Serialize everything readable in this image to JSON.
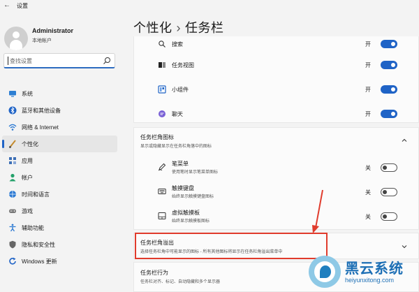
{
  "window": {
    "title": "设置"
  },
  "user": {
    "name": "Administrator",
    "account": "本地帐户"
  },
  "search": {
    "placeholder": "查找设置"
  },
  "nav": [
    {
      "label": "系统",
      "icon": "monitor-icon",
      "color": "#2d7fd3"
    },
    {
      "label": "蓝牙和其他设备",
      "icon": "bluetooth-icon",
      "color": "#1f63c6"
    },
    {
      "label": "网络 & Internet",
      "icon": "wifi-icon",
      "color": "#2a78d2"
    },
    {
      "label": "个性化",
      "icon": "brush-icon",
      "color": "#c48a2c",
      "active": true
    },
    {
      "label": "应用",
      "icon": "apps-icon",
      "color": "#3d6fb5"
    },
    {
      "label": "帐户",
      "icon": "person-icon",
      "color": "#23a06a"
    },
    {
      "label": "时间和语言",
      "icon": "globe-clock-icon",
      "color": "#2a78d2"
    },
    {
      "label": "游戏",
      "icon": "gamepad-icon",
      "color": "#777777"
    },
    {
      "label": "辅助功能",
      "icon": "accessibility-icon",
      "color": "#2a78d2"
    },
    {
      "label": "隐私和安全性",
      "icon": "shield-icon",
      "color": "#666666"
    },
    {
      "label": "Windows 更新",
      "icon": "update-icon",
      "color": "#1f63c6"
    }
  ],
  "breadcrumb": {
    "parent": "个性化",
    "separator": "›",
    "current": "任务栏"
  },
  "taskbar_items": [
    {
      "label": "搜索",
      "state": "开",
      "on": true,
      "icon": "search-icon"
    },
    {
      "label": "任务视图",
      "state": "开",
      "on": true,
      "icon": "task-view-icon"
    },
    {
      "label": "小组件",
      "state": "开",
      "on": true,
      "icon": "widgets-icon"
    },
    {
      "label": "聊天",
      "state": "开",
      "on": true,
      "icon": "chat-icon"
    }
  ],
  "corner_icons": {
    "title": "任务栏角图标",
    "subtitle": "显示或隐藏显示在任务栏角落中的图标",
    "items": [
      {
        "label": "笔菜单",
        "desc": "使用笔时显示笔菜单图标",
        "state": "关",
        "on": false,
        "icon": "pen-icon"
      },
      {
        "label": "触摸键盘",
        "desc": "始终显示触摸键盘图标",
        "state": "关",
        "on": false,
        "icon": "keyboard-icon"
      },
      {
        "label": "虚拟触摸板",
        "desc": "始终显示触摸板图标",
        "state": "关",
        "on": false,
        "icon": "touchpad-icon"
      }
    ]
  },
  "corner_overflow": {
    "title": "任务栏角溢出",
    "subtitle": "选择任务栏角中可能显示的图标 - 所有其他图标将显示在任务栏角溢出菜单中"
  },
  "behaviors": {
    "title": "任务栏行为",
    "subtitle": "任务栏对齐、标记、自动隐藏和多个显示器"
  },
  "watermark": {
    "brand": "黑云系统",
    "url": "heiyunxitong.com"
  },
  "colors": {
    "accent": "#1f63c6",
    "highlight": "#e03b2c"
  }
}
